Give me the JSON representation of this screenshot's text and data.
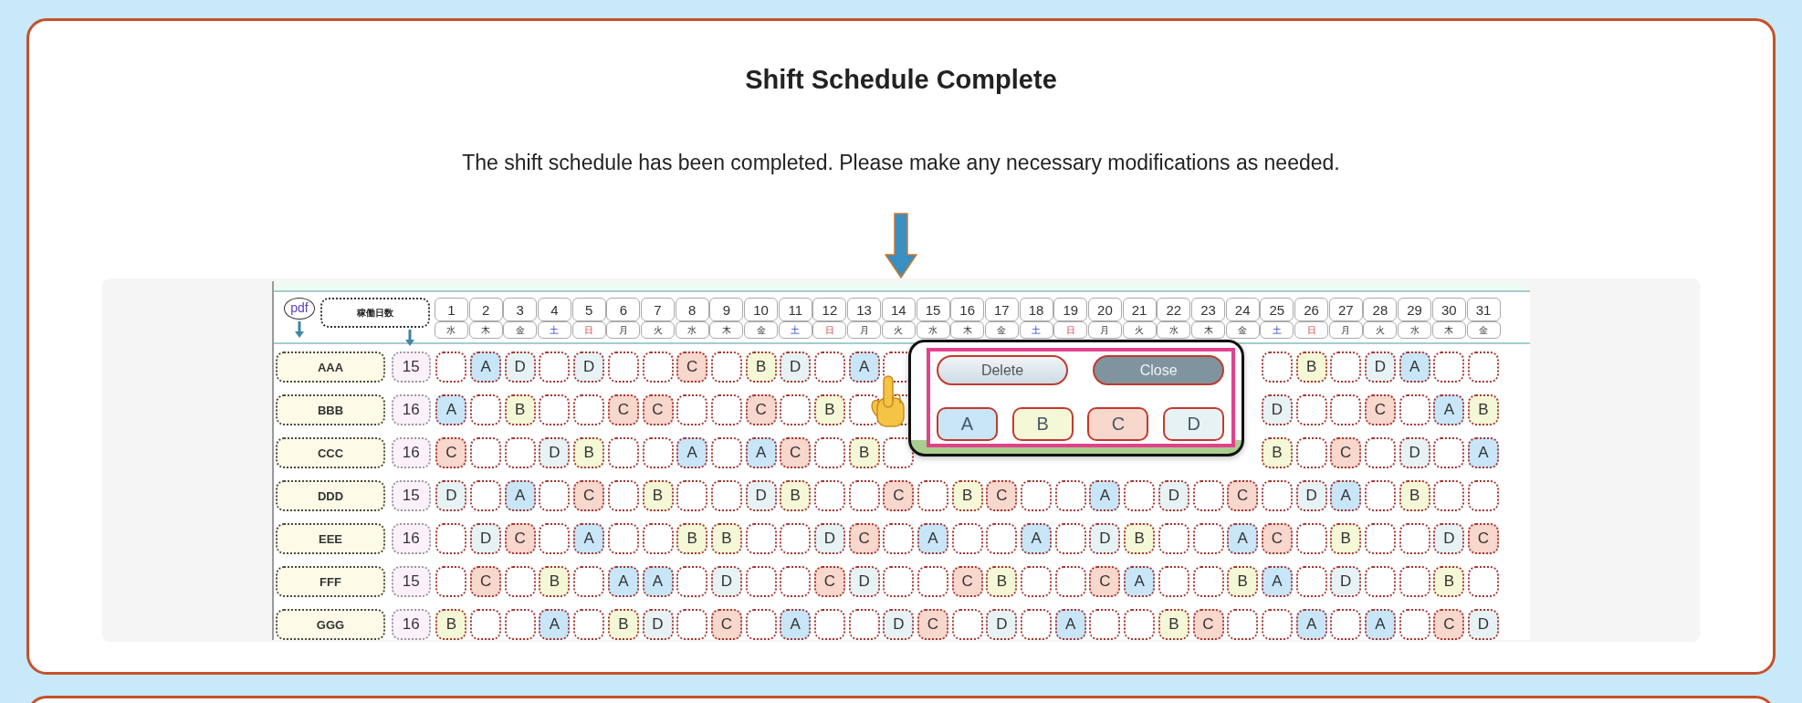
{
  "card": {
    "title": "Shift Schedule Complete",
    "message": "The shift schedule has been completed. Please make any necessary modifications as needed."
  },
  "schedule": {
    "pdf_button": "pdf",
    "days_worked_header": "稼働日数",
    "days": [
      {
        "day": "1",
        "weekday": "水",
        "kind": "weekday"
      },
      {
        "day": "2",
        "weekday": "木",
        "kind": "weekday"
      },
      {
        "day": "3",
        "weekday": "金",
        "kind": "weekday"
      },
      {
        "day": "4",
        "weekday": "土",
        "kind": "saturday"
      },
      {
        "day": "5",
        "weekday": "日",
        "kind": "sunday"
      },
      {
        "day": "6",
        "weekday": "月",
        "kind": "weekday"
      },
      {
        "day": "7",
        "weekday": "火",
        "kind": "weekday"
      },
      {
        "day": "8",
        "weekday": "水",
        "kind": "weekday"
      },
      {
        "day": "9",
        "weekday": "木",
        "kind": "weekday"
      },
      {
        "day": "10",
        "weekday": "金",
        "kind": "weekday"
      },
      {
        "day": "11",
        "weekday": "土",
        "kind": "saturday"
      },
      {
        "day": "12",
        "weekday": "日",
        "kind": "sunday"
      },
      {
        "day": "13",
        "weekday": "月",
        "kind": "weekday"
      },
      {
        "day": "14",
        "weekday": "火",
        "kind": "weekday"
      },
      {
        "day": "15",
        "weekday": "水",
        "kind": "weekday"
      },
      {
        "day": "16",
        "weekday": "木",
        "kind": "weekday"
      },
      {
        "day": "17",
        "weekday": "金",
        "kind": "weekday"
      },
      {
        "day": "18",
        "weekday": "土",
        "kind": "saturday"
      },
      {
        "day": "19",
        "weekday": "日",
        "kind": "sunday"
      },
      {
        "day": "20",
        "weekday": "月",
        "kind": "weekday"
      },
      {
        "day": "21",
        "weekday": "火",
        "kind": "weekday"
      },
      {
        "day": "22",
        "weekday": "水",
        "kind": "weekday"
      },
      {
        "day": "23",
        "weekday": "木",
        "kind": "weekday"
      },
      {
        "day": "24",
        "weekday": "金",
        "kind": "weekday"
      },
      {
        "day": "25",
        "weekday": "土",
        "kind": "saturday"
      },
      {
        "day": "26",
        "weekday": "日",
        "kind": "sunday"
      },
      {
        "day": "27",
        "weekday": "月",
        "kind": "weekday"
      },
      {
        "day": "28",
        "weekday": "火",
        "kind": "weekday"
      },
      {
        "day": "29",
        "weekday": "水",
        "kind": "weekday"
      },
      {
        "day": "30",
        "weekday": "木",
        "kind": "weekday"
      },
      {
        "day": "31",
        "weekday": "金",
        "kind": "weekday"
      }
    ],
    "rows": [
      {
        "name": "AAA",
        "days_worked": "15",
        "cells": [
          null,
          {
            "shift": "A",
            "color": "#c8e6f7"
          },
          {
            "shift": "D",
            "color": "#e7f2f4"
          },
          null,
          {
            "shift": "D",
            "color": "#e7f2f4"
          },
          null,
          null,
          {
            "shift": "C",
            "color": "#f8d7cd"
          },
          null,
          {
            "shift": "B",
            "color": "#f5f8d6"
          },
          {
            "shift": "D",
            "color": "#e7f2f4"
          },
          null,
          {
            "shift": "A",
            "color": "#c8e6f7"
          },
          null,
          null,
          null,
          null,
          null,
          null,
          null,
          null,
          null,
          null,
          null,
          null,
          {
            "shift": "B",
            "color": "#f5f8d6"
          },
          null,
          {
            "shift": "D",
            "color": "#e7f2f4"
          },
          {
            "shift": "A",
            "color": "#c8e6f7"
          },
          null,
          null
        ]
      },
      {
        "name": "BBB",
        "days_worked": "16",
        "cells": [
          {
            "shift": "A",
            "color": "#c8e6f7"
          },
          null,
          {
            "shift": "B",
            "color": "#f5f8d6"
          },
          null,
          null,
          {
            "shift": "C",
            "color": "#f8d7cd"
          },
          {
            "shift": "C",
            "color": "#f8d7cd"
          },
          null,
          null,
          {
            "shift": "C",
            "color": "#f8d7cd"
          },
          null,
          {
            "shift": "B",
            "color": "#f5f8d6"
          },
          null,
          null,
          null,
          null,
          null,
          null,
          null,
          null,
          null,
          null,
          null,
          null,
          {
            "shift": "D",
            "color": "#e7f2f4"
          },
          null,
          null,
          {
            "shift": "C",
            "color": "#f8d7cd"
          },
          null,
          {
            "shift": "A",
            "color": "#c8e6f7"
          },
          {
            "shift": "B",
            "color": "#f5f8d6"
          }
        ]
      },
      {
        "name": "CCC",
        "days_worked": "16",
        "cells": [
          {
            "shift": "C",
            "color": "#f8d7cd"
          },
          null,
          null,
          {
            "shift": "D",
            "color": "#e7f2f4"
          },
          {
            "shift": "B",
            "color": "#f5f8d6"
          },
          null,
          null,
          {
            "shift": "A",
            "color": "#c8e6f7"
          },
          null,
          {
            "shift": "A",
            "color": "#c8e6f7"
          },
          {
            "shift": "C",
            "color": "#f8d7cd"
          },
          null,
          {
            "shift": "B",
            "color": "#f5f8d6"
          },
          null,
          null,
          null,
          null,
          null,
          null,
          null,
          null,
          null,
          null,
          null,
          {
            "shift": "B",
            "color": "#f5f8d6"
          },
          null,
          {
            "shift": "C",
            "color": "#f8d7cd"
          },
          null,
          {
            "shift": "D",
            "color": "#e7f2f4"
          },
          null,
          {
            "shift": "A",
            "color": "#c8e6f7"
          }
        ]
      },
      {
        "name": "DDD",
        "days_worked": "15",
        "cells": [
          {
            "shift": "D",
            "color": "#e7f2f4"
          },
          null,
          {
            "shift": "A",
            "color": "#c8e6f7"
          },
          null,
          {
            "shift": "C",
            "color": "#f8d7cd"
          },
          null,
          {
            "shift": "B",
            "color": "#f5f8d6"
          },
          null,
          null,
          {
            "shift": "D",
            "color": "#e7f2f4"
          },
          {
            "shift": "B",
            "color": "#f5f8d6"
          },
          null,
          null,
          {
            "shift": "C",
            "color": "#f8d7cd"
          },
          null,
          {
            "shift": "B",
            "color": "#f5f8d6"
          },
          {
            "shift": "C",
            "color": "#f8d7cd"
          },
          null,
          null,
          {
            "shift": "A",
            "color": "#c8e6f7"
          },
          null,
          {
            "shift": "D",
            "color": "#e7f2f4"
          },
          null,
          {
            "shift": "C",
            "color": "#f8d7cd"
          },
          null,
          {
            "shift": "D",
            "color": "#e7f2f4"
          },
          {
            "shift": "A",
            "color": "#c8e6f7"
          },
          null,
          {
            "shift": "B",
            "color": "#f5f8d6"
          },
          null,
          null
        ]
      },
      {
        "name": "EEE",
        "days_worked": "16",
        "cells": [
          null,
          {
            "shift": "D",
            "color": "#e7f2f4"
          },
          {
            "shift": "C",
            "color": "#f8d7cd"
          },
          null,
          {
            "shift": "A",
            "color": "#c8e6f7"
          },
          null,
          null,
          {
            "shift": "B",
            "color": "#f5f8d6"
          },
          {
            "shift": "B",
            "color": "#f5f8d6"
          },
          null,
          null,
          {
            "shift": "D",
            "color": "#e7f2f4"
          },
          {
            "shift": "C",
            "color": "#f8d7cd"
          },
          null,
          {
            "shift": "A",
            "color": "#c8e6f7"
          },
          null,
          null,
          {
            "shift": "A",
            "color": "#c8e6f7"
          },
          null,
          {
            "shift": "D",
            "color": "#e7f2f4"
          },
          {
            "shift": "B",
            "color": "#f5f8d6"
          },
          null,
          null,
          {
            "shift": "A",
            "color": "#c8e6f7"
          },
          {
            "shift": "C",
            "color": "#f8d7cd"
          },
          null,
          {
            "shift": "B",
            "color": "#f5f8d6"
          },
          null,
          null,
          {
            "shift": "D",
            "color": "#e7f2f4"
          },
          {
            "shift": "C",
            "color": "#f8d7cd"
          }
        ]
      },
      {
        "name": "FFF",
        "days_worked": "15",
        "cells": [
          null,
          {
            "shift": "C",
            "color": "#f8d7cd"
          },
          null,
          {
            "shift": "B",
            "color": "#f5f8d6"
          },
          null,
          {
            "shift": "A",
            "color": "#c8e6f7"
          },
          {
            "shift": "A",
            "color": "#c8e6f7"
          },
          null,
          {
            "shift": "D",
            "color": "#e7f2f4"
          },
          null,
          null,
          {
            "shift": "C",
            "color": "#f8d7cd"
          },
          {
            "shift": "D",
            "color": "#e7f2f4"
          },
          null,
          null,
          {
            "shift": "C",
            "color": "#f8d7cd"
          },
          {
            "shift": "B",
            "color": "#f5f8d6"
          },
          null,
          null,
          {
            "shift": "C",
            "color": "#f8d7cd"
          },
          {
            "shift": "A",
            "color": "#c8e6f7"
          },
          null,
          null,
          {
            "shift": "B",
            "color": "#f5f8d6"
          },
          {
            "shift": "A",
            "color": "#c8e6f7"
          },
          null,
          {
            "shift": "D",
            "color": "#e7f2f4"
          },
          null,
          null,
          {
            "shift": "B",
            "color": "#f5f8d6"
          },
          null
        ]
      },
      {
        "name": "GGG",
        "days_worked": "16",
        "cells": [
          {
            "shift": "B",
            "color": "#f5f8d6"
          },
          null,
          null,
          {
            "shift": "A",
            "color": "#c8e6f7"
          },
          null,
          {
            "shift": "B",
            "color": "#f5f8d6"
          },
          {
            "shift": "D",
            "color": "#e7f2f4"
          },
          null,
          {
            "shift": "C",
            "color": "#f8d7cd"
          },
          null,
          {
            "shift": "A",
            "color": "#c8e6f7"
          },
          null,
          null,
          {
            "shift": "D",
            "color": "#e7f2f4"
          },
          {
            "shift": "C",
            "color": "#f8d7cd"
          },
          null,
          {
            "shift": "D",
            "color": "#e7f2f4"
          },
          null,
          {
            "shift": "A",
            "color": "#c8e6f7"
          },
          null,
          null,
          {
            "shift": "B",
            "color": "#f5f8d6"
          },
          {
            "shift": "C",
            "color": "#f8d7cd"
          },
          null,
          null,
          {
            "shift": "A",
            "color": "#c8e6f7"
          },
          null,
          {
            "shift": "A",
            "color": "#c8e6f7"
          },
          null,
          {
            "shift": "C",
            "color": "#f8d7cd"
          },
          {
            "shift": "D",
            "color": "#e7f2f4"
          }
        ]
      }
    ],
    "popup": {
      "actions": [
        {
          "label": "Delete",
          "kind": "delete"
        },
        {
          "label": "Close",
          "kind": "close"
        }
      ],
      "options": [
        {
          "label": "A",
          "color": "#c8e6f7"
        },
        {
          "label": "B",
          "color": "#f5f8d6"
        },
        {
          "label": "C",
          "color": "#f8d7cd"
        },
        {
          "label": "D",
          "color": "#e7f2f4"
        }
      ]
    }
  }
}
